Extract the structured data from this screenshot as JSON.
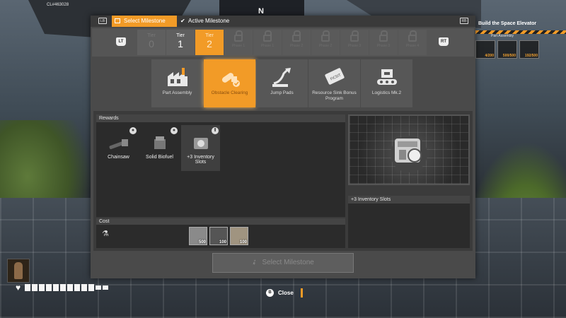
{
  "hud": {
    "client_id": "CL#463028",
    "compass": "N",
    "objective_title": "Build the Space Elevator",
    "objective_sub": "Part Assembly",
    "objective_items": [
      {
        "icon": "plate-icon",
        "count": "4/200"
      },
      {
        "icon": "smart-plating-icon",
        "count": "500/500"
      },
      {
        "icon": "frame-icon",
        "count": "192/500"
      }
    ]
  },
  "tabs": {
    "select_milestone": "Select Milestone",
    "active_milestone": "Active Milestone"
  },
  "tiers": {
    "prev_button": "LT",
    "next_button": "RT",
    "items": [
      {
        "label": "Tier",
        "number": "0",
        "state": "dim"
      },
      {
        "label": "Tier",
        "number": "1",
        "state": "normal"
      },
      {
        "label": "Tier",
        "number": "2",
        "state": "selected"
      },
      {
        "label": "Phase 1",
        "state": "locked"
      },
      {
        "label": "Phase 1",
        "state": "locked"
      },
      {
        "label": "Phase 2",
        "state": "locked"
      },
      {
        "label": "Phase 2",
        "state": "locked"
      },
      {
        "label": "Phase 3",
        "state": "locked"
      },
      {
        "label": "Phase 3",
        "state": "locked"
      },
      {
        "label": "Phase 4",
        "state": "locked"
      }
    ]
  },
  "milestones": [
    {
      "name": "Part Assembly",
      "icon": "factory-icon"
    },
    {
      "name": "Obstacle Clearing",
      "icon": "chainsaw-icon",
      "selected": true
    },
    {
      "name": "Jump Pads",
      "icon": "jump-pad-icon"
    },
    {
      "name": "Resource Sink Bonus Program",
      "icon": "coupon-icon"
    },
    {
      "name": "Logistics Mk.2",
      "icon": "conveyor-icon"
    }
  ],
  "rewards": {
    "header": "Rewards",
    "items": [
      {
        "name": "Chainsaw",
        "icon": "chainsaw-icon",
        "badge": "●"
      },
      {
        "name": "Solid Biofuel",
        "icon": "biofuel-icon",
        "badge": "●"
      },
      {
        "name": "+3 Inventory Slots",
        "icon": "inventory-icon",
        "badge": "⬆"
      }
    ]
  },
  "cost": {
    "header": "Cost",
    "items": [
      {
        "icon": "smart-plating-icon",
        "amount": "500"
      },
      {
        "icon": "cable-icon",
        "amount": "100"
      },
      {
        "icon": "concrete-icon",
        "amount": "100"
      }
    ]
  },
  "detail": {
    "title": "+3 Inventory Slots"
  },
  "select_button": "Select Milestone",
  "close": {
    "button": "B",
    "label": "Close"
  },
  "colors": {
    "accent": "#f29b27",
    "panel": "#4a4a4a"
  }
}
